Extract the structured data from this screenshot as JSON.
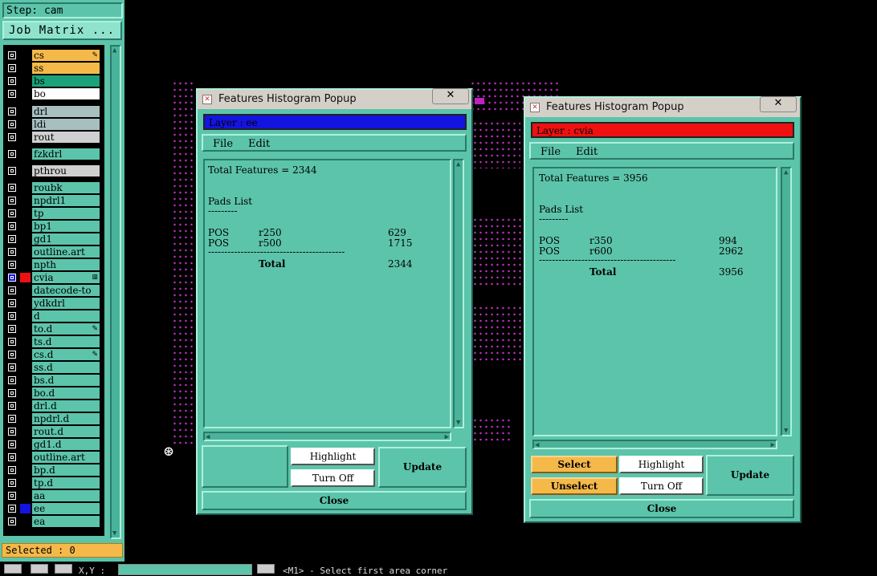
{
  "left_panel": {
    "step_label": "Step: cam",
    "job_matrix_label": "Job Matrix ...",
    "layers": [
      {
        "name": "cs",
        "bg": "#f5b94a",
        "mark": "✎"
      },
      {
        "name": "ss",
        "bg": "#f5b94a",
        "mark": ""
      },
      {
        "name": "bs",
        "bg": "#1aa37a",
        "mark": ""
      },
      {
        "name": "bo",
        "bg": "#ffffff",
        "mark": ""
      },
      {
        "name": "drl",
        "bg": "#a8bfc0",
        "mark": ""
      },
      {
        "name": "ldi",
        "bg": "#a8bfc0",
        "mark": ""
      },
      {
        "name": "rout",
        "bg": "#d0d0d0",
        "mark": ""
      },
      {
        "name": "fzkdrl",
        "bg": "#5cc4aa",
        "mark": ""
      },
      {
        "name": "pthrou",
        "bg": "#d0d0d0",
        "mark": ""
      },
      {
        "name": "roubk",
        "bg": "#5cc4aa",
        "mark": ""
      },
      {
        "name": "npdrl1",
        "bg": "#5cc4aa",
        "mark": ""
      },
      {
        "name": "tp",
        "bg": "#5cc4aa",
        "mark": ""
      },
      {
        "name": "bp1",
        "bg": "#5cc4aa",
        "mark": ""
      },
      {
        "name": "gd1",
        "bg": "#5cc4aa",
        "mark": ""
      },
      {
        "name": "outline.art",
        "bg": "#5cc4aa",
        "mark": ""
      },
      {
        "name": "npth",
        "bg": "#5cc4aa",
        "mark": ""
      },
      {
        "name": "cvia",
        "bg": "#5cc4aa",
        "mark": "⊞"
      },
      {
        "name": "datecode-to",
        "bg": "#5cc4aa",
        "mark": ""
      },
      {
        "name": "ydkdrl",
        "bg": "#5cc4aa",
        "mark": ""
      },
      {
        "name": "d",
        "bg": "#5cc4aa",
        "mark": ""
      },
      {
        "name": "to.d",
        "bg": "#5cc4aa",
        "mark": "✎"
      },
      {
        "name": "ts.d",
        "bg": "#5cc4aa",
        "mark": ""
      },
      {
        "name": "cs.d",
        "bg": "#5cc4aa",
        "mark": "✎"
      },
      {
        "name": "ss.d",
        "bg": "#5cc4aa",
        "mark": ""
      },
      {
        "name": "bs.d",
        "bg": "#5cc4aa",
        "mark": ""
      },
      {
        "name": "bo.d",
        "bg": "#5cc4aa",
        "mark": ""
      },
      {
        "name": "drl.d",
        "bg": "#5cc4aa",
        "mark": ""
      },
      {
        "name": "npdrl.d",
        "bg": "#5cc4aa",
        "mark": ""
      },
      {
        "name": "rout.d",
        "bg": "#5cc4aa",
        "mark": ""
      },
      {
        "name": "gd1.d",
        "bg": "#5cc4aa",
        "mark": ""
      },
      {
        "name": "outline.art",
        "bg": "#5cc4aa",
        "mark": ""
      },
      {
        "name": "bp.d",
        "bg": "#5cc4aa",
        "mark": ""
      },
      {
        "name": "tp.d",
        "bg": "#5cc4aa",
        "mark": ""
      },
      {
        "name": "aa",
        "bg": "#5cc4aa",
        "mark": ""
      },
      {
        "name": "ee",
        "bg": "#5cc4aa",
        "mark": ""
      },
      {
        "name": "ea",
        "bg": "#5cc4aa",
        "mark": ""
      }
    ],
    "selected_text": "Selected : 0"
  },
  "bottom_bar": {
    "xy_label": "X,Y :",
    "status": "<M1> - Select first area corner"
  },
  "popup_left": {
    "title": "Features Histogram Popup",
    "close_x": "✕",
    "layer_label": "Layer :  ee",
    "layer_color": "#1414e0",
    "menu_file": "File",
    "menu_edit": "Edit",
    "total_line": "Total Features = 2344",
    "pads_heading": "Pads List",
    "underline": "---------",
    "rows": [
      {
        "type": "POS",
        "sym": "r250",
        "count": "629"
      },
      {
        "type": "POS",
        "sym": "r500",
        "count": "1715"
      }
    ],
    "separator": "------------------------------------------",
    "total_label": "Total",
    "total_value": "2344",
    "highlight": "Highlight",
    "turn_off": "Turn Off",
    "update": "Update",
    "close": "Close"
  },
  "popup_right": {
    "title": "Features Histogram Popup",
    "close_x": "✕",
    "layer_label": "Layer :  cvia",
    "layer_color": "#ee1111",
    "menu_file": "File",
    "menu_edit": "Edit",
    "total_line": "Total Features = 3956",
    "pads_heading": "Pads List",
    "underline": "---------",
    "rows": [
      {
        "type": "POS",
        "sym": "r350",
        "count": "994"
      },
      {
        "type": "POS",
        "sym": "r600",
        "count": "2962"
      }
    ],
    "separator": "------------------------------------------",
    "total_label": "Total",
    "total_value": "3956",
    "select": "Select",
    "unselect": "Unselect",
    "highlight": "Highlight",
    "turn_off": "Turn Off",
    "update": "Update",
    "close": "Close"
  }
}
